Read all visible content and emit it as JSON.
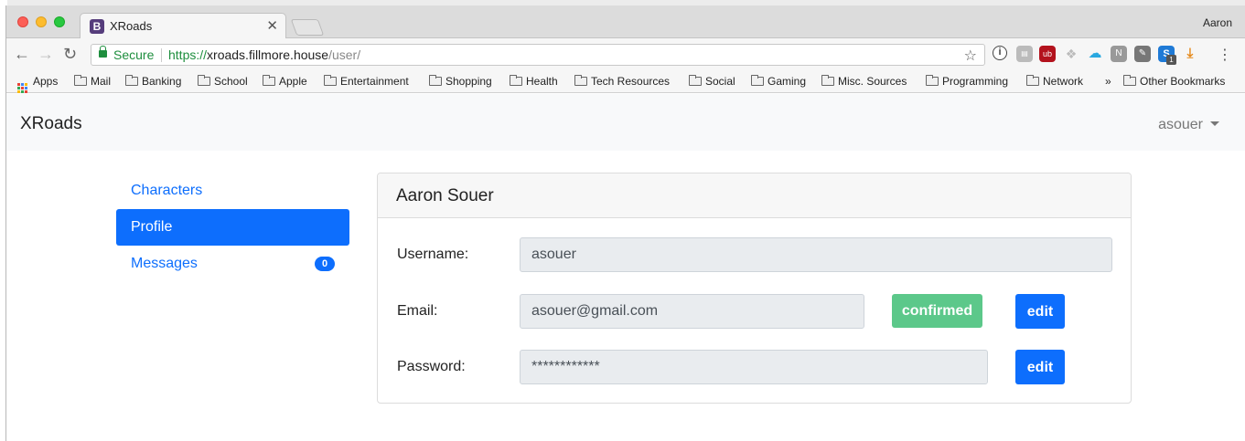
{
  "browser": {
    "tab_title": "XRoads",
    "tab_close": "✕",
    "profile_name": "Aaron",
    "omnibox": {
      "secure_label": "Secure",
      "url_scheme": "https://",
      "url_host": "xroads.fillmore.house",
      "url_path": "/user/"
    },
    "bookmarks": [
      {
        "label": "Apps",
        "icon": "apps-icon"
      },
      {
        "label": "Mail",
        "icon": "folder-icon"
      },
      {
        "label": "Banking",
        "icon": "folder-icon"
      },
      {
        "label": "School",
        "icon": "folder-icon"
      },
      {
        "label": "Apple",
        "icon": "folder-icon"
      },
      {
        "label": "Entertainment",
        "icon": "folder-icon"
      },
      {
        "label": "Shopping",
        "icon": "folder-icon"
      },
      {
        "label": "Health",
        "icon": "folder-icon"
      },
      {
        "label": "Tech Resources",
        "icon": "folder-icon"
      },
      {
        "label": "Social",
        "icon": "folder-icon"
      },
      {
        "label": "Gaming",
        "icon": "folder-icon"
      },
      {
        "label": "Misc. Sources",
        "icon": "folder-icon"
      },
      {
        "label": "Programming",
        "icon": "folder-icon"
      },
      {
        "label": "Network",
        "icon": "folder-icon"
      }
    ],
    "bookmarks_overflow": "»",
    "other_bookmarks": "Other Bookmarks",
    "extension_badge": "1"
  },
  "app": {
    "brand": "XRoads",
    "user_menu": "asouer"
  },
  "sidebar": {
    "items": [
      {
        "label": "Characters",
        "active": false
      },
      {
        "label": "Profile",
        "active": true
      },
      {
        "label": "Messages",
        "active": false,
        "badge": "0"
      }
    ]
  },
  "profile": {
    "title": "Aaron Souer",
    "username_label": "Username:",
    "username_value": "asouer",
    "email_label": "Email:",
    "email_value": "asouer@gmail.com",
    "email_status": "confirmed",
    "password_label": "Password:",
    "password_value": "************",
    "edit_label": "edit"
  },
  "colors": {
    "primary": "#0d6efd",
    "success": "#5cc88a",
    "secure": "#1e8e3e"
  }
}
